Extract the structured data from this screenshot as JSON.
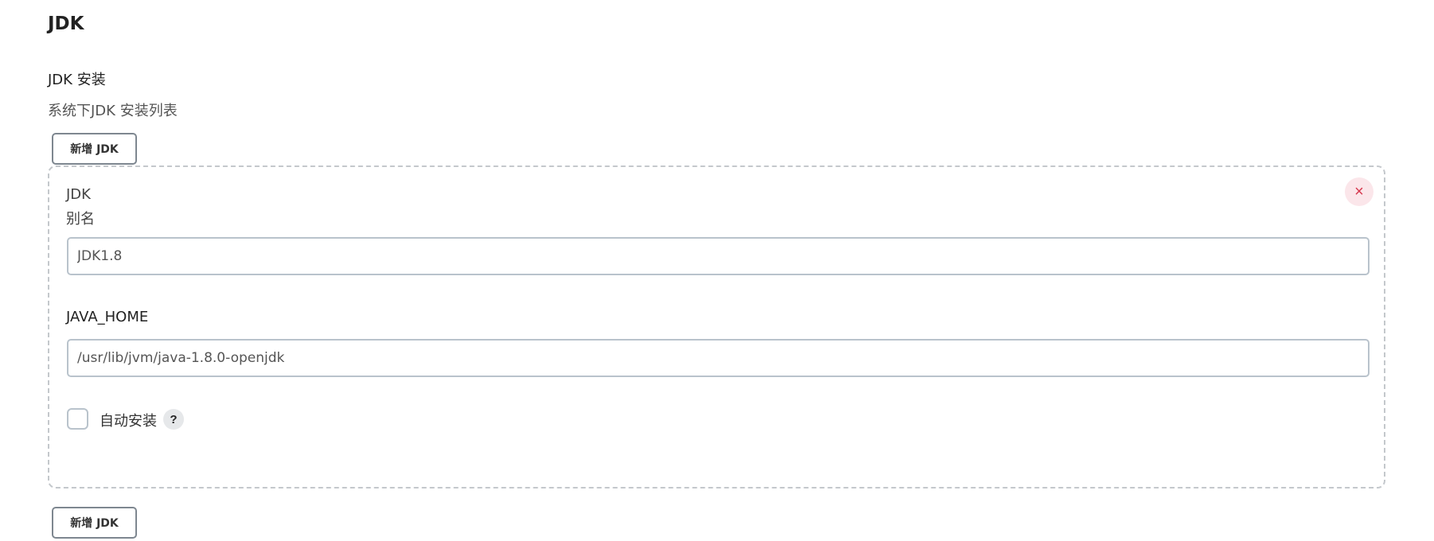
{
  "section": {
    "title": "JDK"
  },
  "installations": {
    "label": "JDK 安装",
    "description": "系统下JDK 安装列表",
    "add_button_label": "新增 JDK"
  },
  "jdk_item": {
    "type_label": "JDK",
    "alias_label": "别名",
    "alias_value": "JDK1.8",
    "java_home_label": "JAVA_HOME",
    "java_home_value": "/usr/lib/jvm/java-1.8.0-openjdk",
    "auto_install_label": "自动安装",
    "auto_install_checked": false,
    "help_glyph": "?",
    "close_glyph": "×",
    "close_icon": "close-icon",
    "help_icon": "help-icon"
  },
  "colors": {
    "close_bg": "#fbe6ea",
    "close_fg": "#d6394f",
    "border": "#b9c3cc"
  }
}
